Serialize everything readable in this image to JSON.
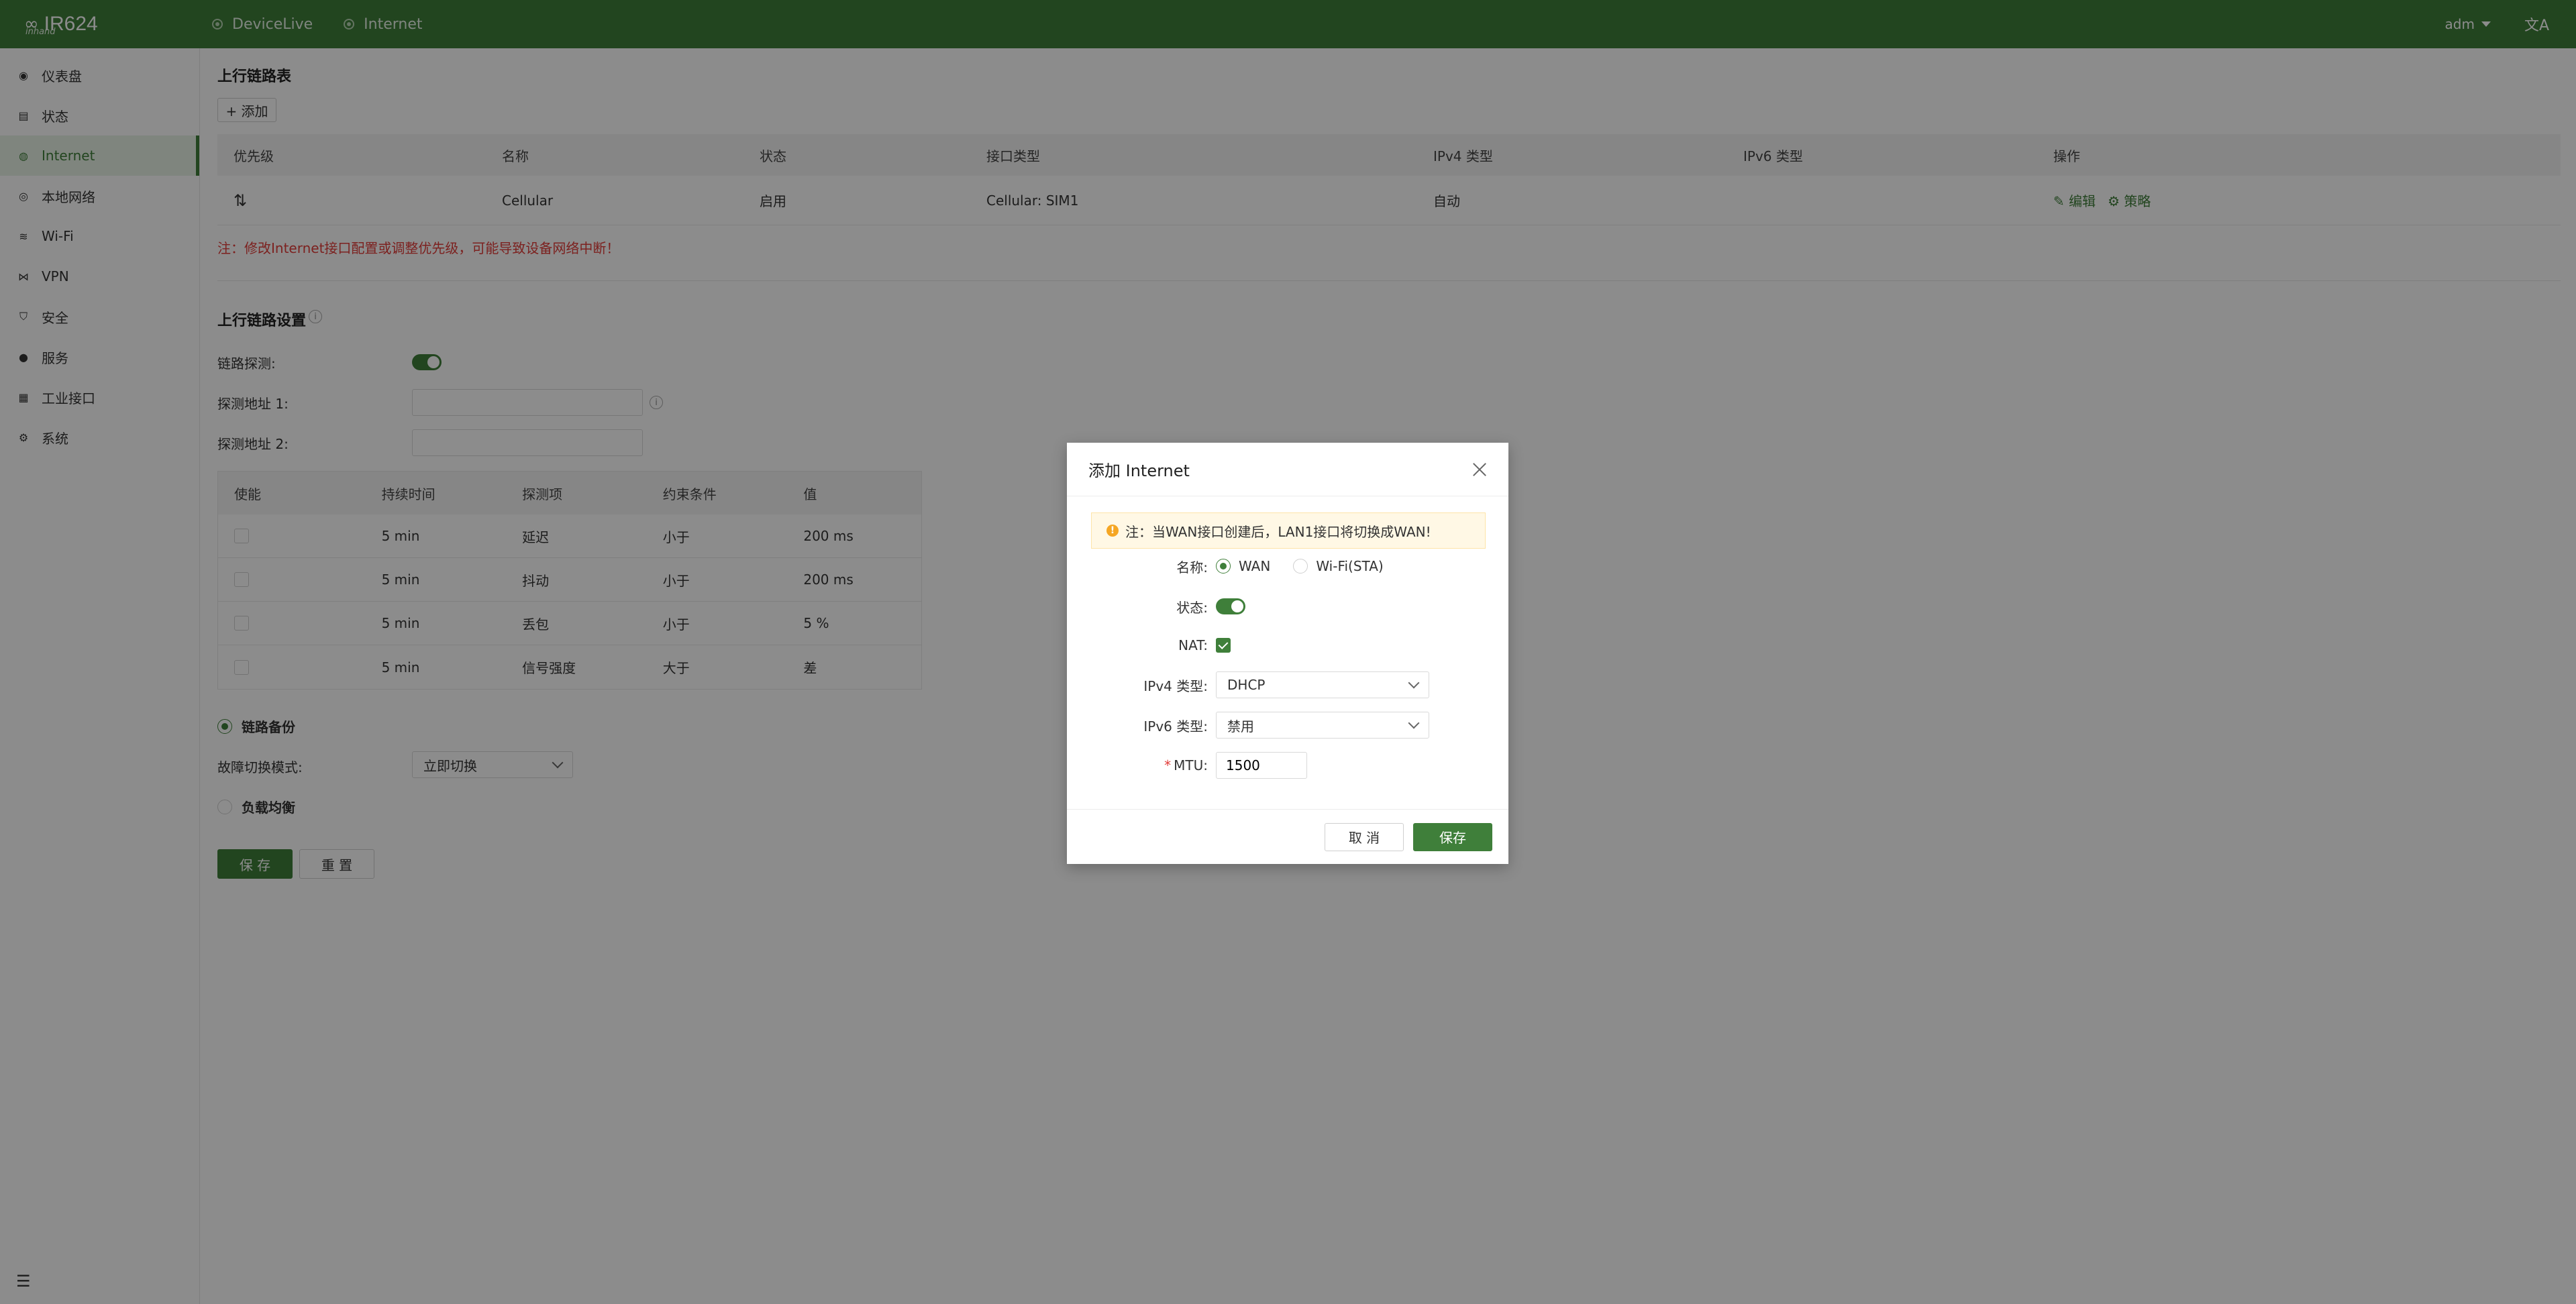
{
  "topbar": {
    "brand": "IR624",
    "brand_sub": "inhand",
    "crumbs": [
      "DeviceLive",
      "Internet"
    ],
    "user": "adm",
    "lang_icon": "translate-icon"
  },
  "sidebar": {
    "items": [
      {
        "label": "仪表盘",
        "icon": "dashboard-icon"
      },
      {
        "label": "状态",
        "icon": "status-icon"
      },
      {
        "label": "Internet",
        "icon": "internet-icon",
        "active": true
      },
      {
        "label": "本地网络",
        "icon": "local-network-icon"
      },
      {
        "label": "Wi-Fi",
        "icon": "wifi-icon"
      },
      {
        "label": "VPN",
        "icon": "vpn-icon"
      },
      {
        "label": "安全",
        "icon": "security-icon"
      },
      {
        "label": "服务",
        "icon": "service-icon"
      },
      {
        "label": "工业接口",
        "icon": "industrial-icon"
      },
      {
        "label": "系统",
        "icon": "gear-icon"
      }
    ]
  },
  "uplink": {
    "title": "上行链路表",
    "add_label": "+ 添加",
    "headers": [
      "优先级",
      "名称",
      "状态",
      "接口类型",
      "IPv4 类型",
      "IPv6 类型",
      "操作"
    ],
    "rows": [
      {
        "name": "Cellular",
        "status": "启用",
        "iface": "Cellular: SIM1",
        "ipv4": "自动",
        "ipv6": "",
        "edit": "编辑",
        "policy": "策略"
      }
    ],
    "warning": "注：修改Internet接口配置或调整优先级，可能导致设备网络中断！"
  },
  "settings": {
    "title": "上行链路设置",
    "detect_label": "链路探测:",
    "addr1_label": "探测地址 1:",
    "addr2_label": "探测地址 2:",
    "headers": [
      "使能",
      "持续时间",
      "探测项",
      "约束条件",
      "值"
    ],
    "rows": [
      {
        "duration": "5 min",
        "item": "延迟",
        "cond": "小于",
        "value": "200 ms"
      },
      {
        "duration": "5 min",
        "item": "抖动",
        "cond": "小于",
        "value": "200 ms"
      },
      {
        "duration": "5 min",
        "item": "丢包",
        "cond": "小于",
        "value": "5 %"
      },
      {
        "duration": "5 min",
        "item": "信号强度",
        "cond": "大于",
        "value": "差"
      }
    ],
    "backup_label": "链路备份",
    "failover_label": "故障切换模式:",
    "failover_value": "立即切换",
    "balance_label": "负载均衡",
    "save_label": "保 存",
    "reset_label": "重 置"
  },
  "modal": {
    "title": "添加 Internet",
    "alert": "注：当WAN接口创建后，LAN1接口将切换成WAN!",
    "name_label": "名称:",
    "name_options": [
      "WAN",
      "Wi-Fi(STA)"
    ],
    "status_label": "状态:",
    "nat_label": "NAT:",
    "ipv4_label": "IPv4 类型:",
    "ipv4_value": "DHCP",
    "ipv6_label": "IPv6 类型:",
    "ipv6_value": "禁用",
    "mtu_label": "MTU:",
    "mtu_value": "1500",
    "cancel_label": "取 消",
    "save_label": "保存"
  }
}
